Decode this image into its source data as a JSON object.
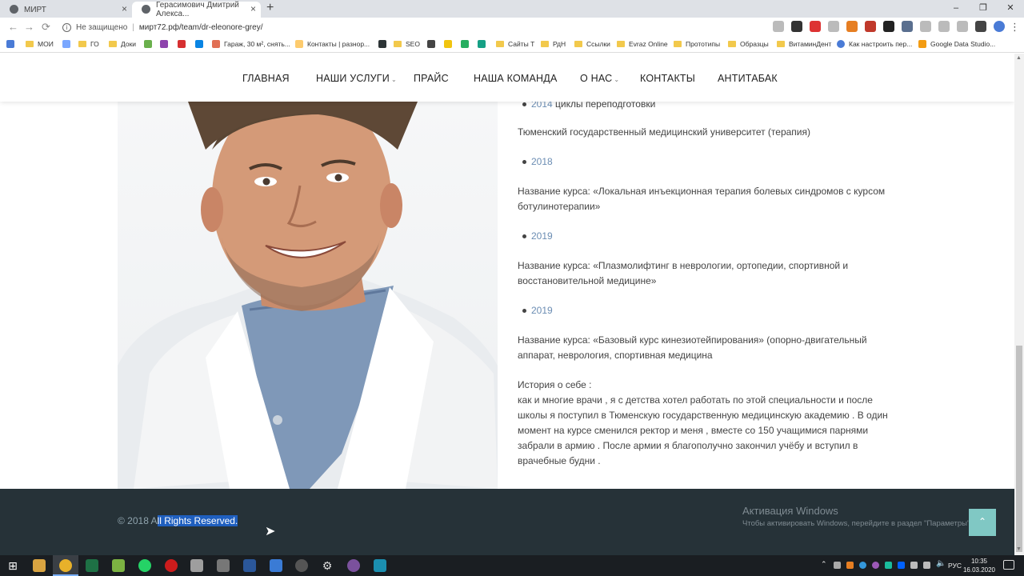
{
  "browser": {
    "tabs": [
      {
        "title": "МИРТ"
      },
      {
        "title": "Герасимович Дмитрий Алекса..."
      }
    ],
    "security_label": "Не защищено",
    "url": "мирт72.рф/team/dr-eleonore-grey/",
    "window_controls": {
      "minimize": "–",
      "restore": "❐",
      "close": "✕"
    },
    "bookmarks": [
      "МОИ",
      "ГО",
      "Доки",
      "Гараж, 30 м², снять...",
      "Контакты | разнор...",
      "SEO",
      "Сайты Т",
      "РдН",
      "Ссылки",
      "Evraz Online",
      "Прототипы",
      "Образцы",
      "ВитаминДент",
      "Как настроить пер...",
      "Google Data Studio..."
    ]
  },
  "site": {
    "nav": {
      "items": [
        "ГЛАВНАЯ",
        "НАШИ УСЛУГИ",
        "ПРАЙС",
        "НАША КОМАНДА",
        "О НАС",
        "КОНТАКТЫ",
        "АНТИТАБАК"
      ]
    },
    "content": {
      "bullet_top": {
        "year": "2014",
        "text": "циклы переподготовки"
      },
      "uni": "Тюменский государственный медицинский университет (терапия)",
      "bullet_1": {
        "year": "2018"
      },
      "course_1": "Название курса: «Локальная инъекционная терапия болевых синдромов с курсом ботулинотерапии»",
      "bullet_2": {
        "year": "2019"
      },
      "course_2": "Название курса: «Плазмолифтинг в неврологии, ортопедии, спортивной и восстановительной медицине»",
      "bullet_3": {
        "year": "2019"
      },
      "course_3": "Название курса: «Базовый курс кинезиотейпирования» (опорно-двигательный аппарат, неврология, спортивная медицина",
      "about_title": "История о себе :",
      "about_text": "как и многие врачи , я с детства хотел работать по этой специальности и после школы я поступил в Тюменскую государственную медицинскую академию . В один момент на курсе сменился ректор и меня , вместе со 150 учащимися парнями забрали в армию . После армии я благополучно закончил учёбу и вступил в врачебные будни ."
    },
    "footer": {
      "copyright_prefix": "© 2018 A",
      "copyright_selected": "ll Rights Reserved.",
      "activation_title": "Активация Windows",
      "activation_text": "Чтобы активировать Windows, перейдите в раздел \"Параметры\".",
      "to_top": "⌃"
    }
  },
  "taskbar": {
    "language": "РУС",
    "time": "10:35",
    "date": "16.03.2020"
  },
  "colors": {
    "footer_bg": "#263238",
    "selection": "#1f5fbf",
    "to_top_btn": "#80c8c4",
    "year_accent": "#6b8db3"
  }
}
